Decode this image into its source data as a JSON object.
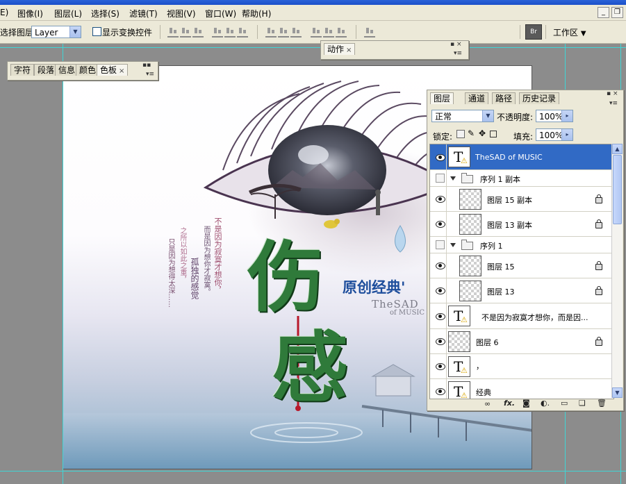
{
  "menubar": {
    "items": [
      "图像(I)",
      "图层(L)",
      "选择(S)",
      "滤镜(T)",
      "视图(V)",
      "窗口(W)",
      "帮助(H)"
    ],
    "edit_fragment": "E)"
  },
  "options": {
    "select_layer_label": "选择图层",
    "layer_select_value": "Layer",
    "show_transform_label": "显示变换控件",
    "workspace_label": "工作区",
    "workspace_arrow": "▼",
    "dropdown_arrow": "▼"
  },
  "window_controls": {
    "minimize": "_",
    "restore": "❐"
  },
  "actions_panel": {
    "tab": "动作",
    "close": "×"
  },
  "char_panel": {
    "tabs": [
      "字符",
      "段落",
      "信息",
      "颜色",
      "色板"
    ],
    "close": "×"
  },
  "layers_panel": {
    "tabs": [
      "图层",
      "通道",
      "路径",
      "历史记录"
    ],
    "blend_mode": "正常",
    "opacity_label": "不透明度:",
    "opacity_value": "100%",
    "lock_label": "锁定:",
    "fill_label": "填充:",
    "fill_value": "100%",
    "arrow": "▸",
    "layers": [
      {
        "name": "TheSAD       of MUSIC",
        "type": "text",
        "visible": true,
        "selected": true,
        "locked": false
      },
      {
        "name": "序列 1 副本",
        "type": "group",
        "visible": false,
        "selected": false,
        "locked": false
      },
      {
        "name": "图层 15 副本",
        "type": "pixel",
        "visible": true,
        "selected": false,
        "locked": true
      },
      {
        "name": "图层 13 副本",
        "type": "pixel",
        "visible": true,
        "selected": false,
        "locked": true
      },
      {
        "name": "序列 1",
        "type": "group",
        "visible": false,
        "selected": false,
        "locked": false
      },
      {
        "name": "图层 15",
        "type": "pixel",
        "visible": true,
        "selected": false,
        "locked": true
      },
      {
        "name": "图层 13",
        "type": "pixel",
        "visible": true,
        "selected": false,
        "locked": true
      },
      {
        "name": "不是因为寂寞才想你，而是因...",
        "type": "text",
        "visible": true,
        "selected": false,
        "locked": false
      },
      {
        "name": "图层 6",
        "type": "pixel",
        "visible": true,
        "selected": false,
        "locked": true
      },
      {
        "name": "，",
        "type": "text",
        "visible": true,
        "selected": false,
        "locked": false
      },
      {
        "name": "经典",
        "type": "text",
        "visible": true,
        "selected": false,
        "locked": false
      }
    ],
    "bottom_tools": {
      "link": "∞",
      "fx": "fx.",
      "mask": "◙",
      "adjust": "◐.",
      "folder": "▭",
      "new": "❑",
      "trash": "🗑"
    }
  },
  "artwork": {
    "title_chars": [
      "伤",
      "感"
    ],
    "badge": "原创经典'",
    "english_line1": "TheSAD",
    "english_line2": "of MUSIC",
    "poem_columns": [
      {
        "text": "不是因为寂寞才想你，",
        "color": "#a05070"
      },
      {
        "text": "而是因为想你才寂寞。",
        "color": "#6a5070"
      },
      {
        "text": "孤独的感觉",
        "color": "#5a3c64"
      },
      {
        "text": "之所以如此之重，",
        "color": "#b07090"
      },
      {
        "text": "只是因为想得太深……",
        "color": "#7a5070"
      }
    ],
    "colors": {
      "green": "#2f7a3a",
      "blue": "#1e4e9c",
      "iris": "#3a3b4a",
      "lash": "#3e2a46"
    }
  }
}
